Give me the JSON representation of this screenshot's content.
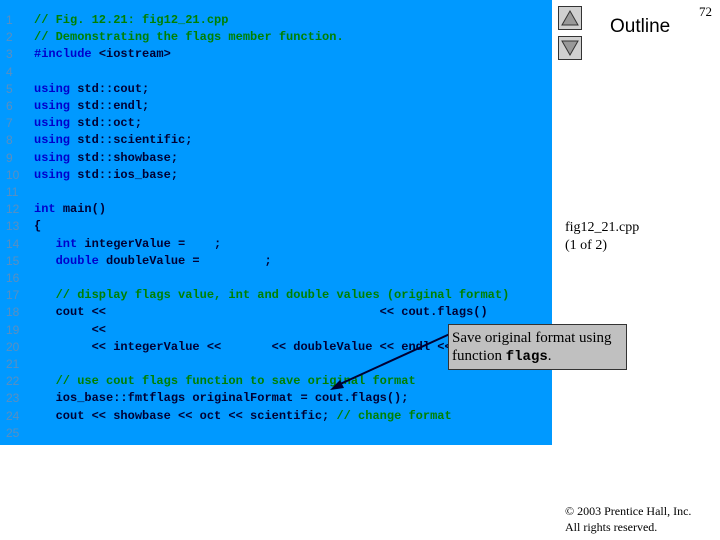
{
  "page_number": "72",
  "nav": {
    "outline_label": "Outline",
    "up_icon": "triangle-up",
    "down_icon": "triangle-down"
  },
  "file_label": {
    "name": "fig12_21.cpp",
    "part": "(1 of 2)"
  },
  "callout": {
    "text": "Save original format using function ",
    "code": "flags",
    "end": "."
  },
  "copyright": {
    "line1": "© 2003 Prentice Hall, Inc.",
    "line2": "All rights reserved."
  },
  "colors": {
    "code_bg": "#0099ff",
    "keyword": "#0000cc",
    "comment": "#008000",
    "callout_bg": "#c0c0c0"
  },
  "code": [
    {
      "n": "1",
      "segs": [
        [
          "cm",
          "// Fig. 12.21: fig12_21.cpp"
        ]
      ]
    },
    {
      "n": "2",
      "segs": [
        [
          "cm",
          "// Demonstrating the flags member function."
        ]
      ]
    },
    {
      "n": "3",
      "segs": [
        [
          "kw",
          "#include "
        ],
        [
          "pl",
          "<iostream>"
        ]
      ]
    },
    {
      "n": "4",
      "segs": []
    },
    {
      "n": "5",
      "segs": [
        [
          "kw",
          "using "
        ],
        [
          "pl",
          "std::cout;"
        ]
      ]
    },
    {
      "n": "6",
      "segs": [
        [
          "kw",
          "using "
        ],
        [
          "pl",
          "std::endl;"
        ]
      ]
    },
    {
      "n": "7",
      "segs": [
        [
          "kw",
          "using "
        ],
        [
          "pl",
          "std::oct;"
        ]
      ]
    },
    {
      "n": "8",
      "segs": [
        [
          "kw",
          "using "
        ],
        [
          "pl",
          "std::scientific;"
        ]
      ]
    },
    {
      "n": "9",
      "segs": [
        [
          "kw",
          "using "
        ],
        [
          "pl",
          "std::showbase;"
        ]
      ]
    },
    {
      "n": "10",
      "segs": [
        [
          "kw",
          "using "
        ],
        [
          "pl",
          "std::ios_base;"
        ]
      ]
    },
    {
      "n": "11",
      "segs": []
    },
    {
      "n": "12",
      "segs": [
        [
          "kw",
          "int "
        ],
        [
          "pl",
          "main()"
        ]
      ]
    },
    {
      "n": "13",
      "segs": [
        [
          "pl",
          "{"
        ]
      ]
    },
    {
      "n": "14",
      "segs": [
        [
          "kw",
          "   int "
        ],
        [
          "pl",
          "integerValue =    ;"
        ]
      ]
    },
    {
      "n": "15",
      "segs": [
        [
          "kw",
          "   double "
        ],
        [
          "pl",
          "doubleValue =         ;"
        ]
      ]
    },
    {
      "n": "16",
      "segs": []
    },
    {
      "n": "17",
      "segs": [
        [
          "cm",
          "   // display flags value, int and double values (original format)"
        ]
      ]
    },
    {
      "n": "18",
      "segs": [
        [
          "pl",
          "   cout <<                                      << cout.flags()"
        ]
      ]
    },
    {
      "n": "19",
      "segs": [
        [
          "pl",
          "        <<"
        ]
      ]
    },
    {
      "n": "20",
      "segs": [
        [
          "pl",
          "        << integerValue <<       << doubleValue << endl <<"
        ]
      ]
    },
    {
      "n": "21",
      "segs": []
    },
    {
      "n": "22",
      "segs": [
        [
          "cm",
          "   // use cout flags function to save original format"
        ]
      ]
    },
    {
      "n": "23",
      "segs": [
        [
          "pl",
          "   ios_base::fmtflags originalFormat = cout.flags();"
        ]
      ]
    },
    {
      "n": "24",
      "segs": [
        [
          "pl",
          "   cout << showbase << oct << scientific; "
        ],
        [
          "cm",
          "// change format"
        ]
      ]
    },
    {
      "n": "25",
      "segs": []
    }
  ]
}
